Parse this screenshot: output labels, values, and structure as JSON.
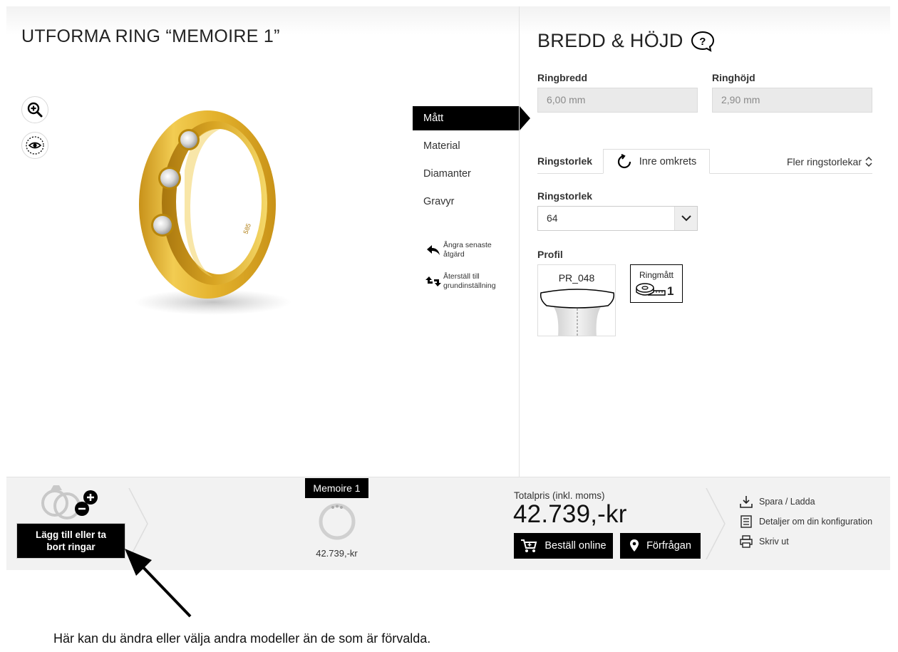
{
  "left": {
    "title": "UTFORMA RING “MEMOIRE 1”",
    "tools": [
      {
        "icon": "zoom-in-icon"
      },
      {
        "icon": "eye-icon"
      }
    ],
    "ring_engraving": "585",
    "tabs": [
      {
        "label": "Mått",
        "active": true
      },
      {
        "label": "Material",
        "active": false
      },
      {
        "label": "Diamanter",
        "active": false
      },
      {
        "label": "Gravyr",
        "active": false
      }
    ],
    "undo": {
      "line1": "Ångra senaste",
      "line2": "åtgärd",
      "icon": "undo-icon"
    },
    "reset": {
      "line1": "Återställ till",
      "line2": "grundinställning",
      "icon": "reset-icon"
    }
  },
  "right": {
    "title": "BREDD & HÖJD",
    "help_symbol": "?",
    "ring_width": {
      "label": "Ringbredd",
      "value": "6,00 mm"
    },
    "ring_height": {
      "label": "Ringhöjd",
      "value": "2,90 mm"
    },
    "size_tabs": {
      "label": "Ringstorlek",
      "active_tab": "Inre omkrets",
      "more": "Fler ringstorlekar"
    },
    "size_select": {
      "label": "Ringstorlek",
      "value": "64"
    },
    "profile": {
      "label": "Profil",
      "name": "PR_048",
      "measure_label": "Ringmått",
      "measure_number": "1"
    }
  },
  "bar": {
    "add_button": {
      "line1": "Lägg till eller ta",
      "line2": "bort ringar"
    },
    "model": {
      "name": "Memoire 1",
      "price": "42.739,-kr"
    },
    "total": {
      "label": "Totalpris (inkl. moms)",
      "value": "42.739,-kr"
    },
    "order_button": "Beställ online",
    "inquiry_button": "Förfrågan",
    "links": [
      {
        "label": "Spara / Ladda",
        "icon": "download-icon"
      },
      {
        "label": "Detaljer om din konfiguration",
        "icon": "list-icon"
      },
      {
        "label": "Skriv ut",
        "icon": "printer-icon"
      }
    ]
  },
  "caption": "Här kan du ändra eller välja andra modeller än de som är förvalda.",
  "colors": {
    "accent": "#000000",
    "gold": "#e2b52a",
    "bar_bg": "#f2f2f2",
    "input_bg": "#eaeaea"
  }
}
